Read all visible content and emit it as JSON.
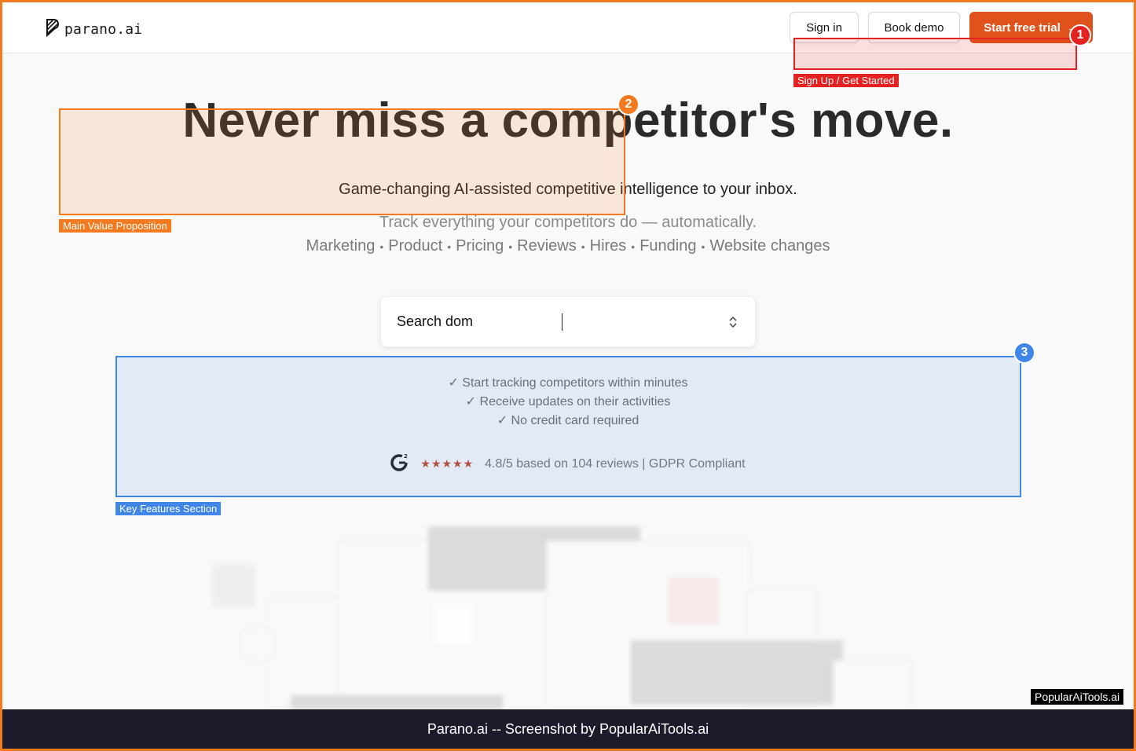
{
  "header": {
    "logo_text": "parano.ai",
    "sign_in_label": "Sign in",
    "book_demo_label": "Book demo",
    "start_trial_label": "Start free trial",
    "start_trial_arrow": "→"
  },
  "hero": {
    "headline": "Never miss a competitor's move.",
    "subheadline": "Game-changing AI-assisted competitive intelligence to your inbox.",
    "tagline": "Track everything your competitors do — automatically.",
    "categories": [
      "Marketing",
      "Product",
      "Pricing",
      "Reviews",
      "Hires",
      "Funding",
      "Website changes"
    ]
  },
  "search": {
    "value": "Search dom"
  },
  "features": {
    "items": [
      "✓ Start tracking competitors within minutes",
      "✓ Receive updates on their activities",
      "✓ No credit card required"
    ],
    "stars": "★★★★★",
    "rating_text": "4.8/5 based on 104 reviews | GDPR Compliant"
  },
  "annotations": [
    {
      "number": "1",
      "label": "Sign Up / Get Started",
      "color": "#e52222"
    },
    {
      "number": "2",
      "label": "Main Value Proposition",
      "color": "#f47a20"
    },
    {
      "number": "3",
      "label": "Key Features Section",
      "color": "#3f86e8"
    }
  ],
  "footer": {
    "caption": "Parano.ai -- Screenshot by PopularAiTools.ai",
    "watermark": "PopularAiTools.ai"
  },
  "colors": {
    "brand_orange": "#e0521b",
    "frame": "#f47a20",
    "footer_bg": "#1b1b2b"
  }
}
